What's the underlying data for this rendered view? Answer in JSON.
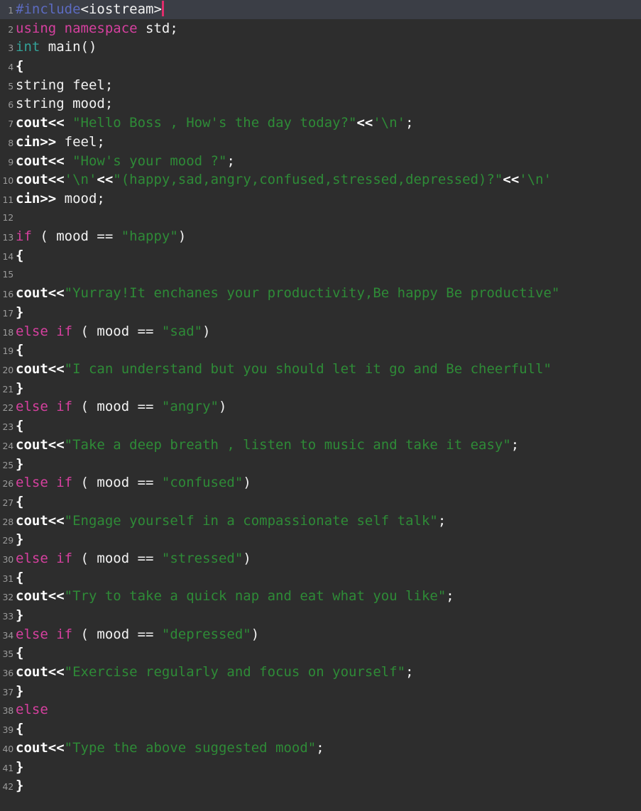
{
  "editor": {
    "language": "C++",
    "background_color": "#2d2d2d",
    "active_line_color": "#3b3e46",
    "gutter_color": "#9a9a9a",
    "cursor_color": "#e02d6b",
    "cursor_line": 1,
    "total_lines": 42,
    "colors": {
      "preprocessor": "#5c6bc0",
      "keyword": "#d6409f",
      "type": "#33a298",
      "string": "#2e8b37",
      "plain": "#f2f2f2"
    }
  },
  "lines": [
    {
      "n": "1",
      "active": true,
      "tokens": [
        {
          "c": "pre",
          "t": "#include"
        },
        {
          "c": "plain",
          "t": "<iostream>"
        }
      ],
      "cursor": true
    },
    {
      "n": "2",
      "active": false,
      "tokens": [
        {
          "c": "kw",
          "t": "using namespace"
        },
        {
          "c": "plain",
          "t": " std;"
        }
      ]
    },
    {
      "n": "3",
      "active": false,
      "tokens": [
        {
          "c": "type",
          "t": "int"
        },
        {
          "c": "plain",
          "t": " main()"
        }
      ]
    },
    {
      "n": "4",
      "active": false,
      "tokens": [
        {
          "c": "bold",
          "t": "{"
        }
      ]
    },
    {
      "n": "5",
      "active": false,
      "tokens": [
        {
          "c": "plain",
          "t": "string feel;"
        }
      ]
    },
    {
      "n": "6",
      "active": false,
      "tokens": [
        {
          "c": "plain",
          "t": "string mood;"
        }
      ]
    },
    {
      "n": "7",
      "active": false,
      "tokens": [
        {
          "c": "bold",
          "t": "cout<<"
        },
        {
          "c": "plain",
          "t": " "
        },
        {
          "c": "str",
          "t": "\"Hello Boss , How's the day today?\""
        },
        {
          "c": "bold",
          "t": "<<"
        },
        {
          "c": "str",
          "t": "'\\n'"
        },
        {
          "c": "plain",
          "t": ";"
        }
      ]
    },
    {
      "n": "8",
      "active": false,
      "tokens": [
        {
          "c": "bold",
          "t": "cin>>"
        },
        {
          "c": "plain",
          "t": " feel;"
        }
      ]
    },
    {
      "n": "9",
      "active": false,
      "tokens": [
        {
          "c": "bold",
          "t": "cout<<"
        },
        {
          "c": "plain",
          "t": " "
        },
        {
          "c": "str",
          "t": "\"How's your mood ?\""
        },
        {
          "c": "plain",
          "t": ";"
        }
      ]
    },
    {
      "n": "10",
      "active": false,
      "tokens": [
        {
          "c": "bold",
          "t": "cout<<"
        },
        {
          "c": "str",
          "t": "'\\n'"
        },
        {
          "c": "bold",
          "t": "<<"
        },
        {
          "c": "str",
          "t": "\"(happy,sad,angry,confused,stressed,depressed)?\""
        },
        {
          "c": "bold",
          "t": "<<"
        },
        {
          "c": "str",
          "t": "'\\n'"
        }
      ]
    },
    {
      "n": "11",
      "active": false,
      "tokens": [
        {
          "c": "bold",
          "t": "cin>>"
        },
        {
          "c": "plain",
          "t": " mood;"
        }
      ]
    },
    {
      "n": "12",
      "active": false,
      "tokens": []
    },
    {
      "n": "13",
      "active": false,
      "tokens": [
        {
          "c": "kw",
          "t": "if"
        },
        {
          "c": "plain",
          "t": " ( mood == "
        },
        {
          "c": "str",
          "t": "\"happy\""
        },
        {
          "c": "plain",
          "t": ")"
        }
      ]
    },
    {
      "n": "14",
      "active": false,
      "tokens": [
        {
          "c": "bold",
          "t": "{"
        }
      ]
    },
    {
      "n": "15",
      "active": false,
      "tokens": []
    },
    {
      "n": "16",
      "active": false,
      "tokens": [
        {
          "c": "bold",
          "t": "cout<<"
        },
        {
          "c": "str",
          "t": "\"Yurray!It enchanes your productivity,Be happy Be productive\""
        }
      ]
    },
    {
      "n": "17",
      "active": false,
      "tokens": [
        {
          "c": "bold",
          "t": "}"
        }
      ]
    },
    {
      "n": "18",
      "active": false,
      "tokens": [
        {
          "c": "kw",
          "t": "else if"
        },
        {
          "c": "plain",
          "t": " ( mood == "
        },
        {
          "c": "str",
          "t": "\"sad\""
        },
        {
          "c": "plain",
          "t": ")"
        }
      ]
    },
    {
      "n": "19",
      "active": false,
      "tokens": [
        {
          "c": "bold",
          "t": "{"
        }
      ]
    },
    {
      "n": "20",
      "active": false,
      "tokens": [
        {
          "c": "bold",
          "t": "cout<<"
        },
        {
          "c": "str",
          "t": "\"I can understand but you should let it go and Be cheerfull\""
        }
      ]
    },
    {
      "n": "21",
      "active": false,
      "tokens": [
        {
          "c": "bold",
          "t": "}"
        }
      ]
    },
    {
      "n": "22",
      "active": false,
      "tokens": [
        {
          "c": "kw",
          "t": "else if"
        },
        {
          "c": "plain",
          "t": " ( mood == "
        },
        {
          "c": "str",
          "t": "\"angry\""
        },
        {
          "c": "plain",
          "t": ")"
        }
      ]
    },
    {
      "n": "23",
      "active": false,
      "tokens": [
        {
          "c": "bold",
          "t": "{"
        }
      ]
    },
    {
      "n": "24",
      "active": false,
      "tokens": [
        {
          "c": "bold",
          "t": "cout<<"
        },
        {
          "c": "str",
          "t": "\"Take a deep breath , listen to music and take it easy\""
        },
        {
          "c": "plain",
          "t": ";"
        }
      ]
    },
    {
      "n": "25",
      "active": false,
      "tokens": [
        {
          "c": "bold",
          "t": "}"
        }
      ]
    },
    {
      "n": "26",
      "active": false,
      "tokens": [
        {
          "c": "kw",
          "t": "else if"
        },
        {
          "c": "plain",
          "t": " ( mood == "
        },
        {
          "c": "str",
          "t": "\"confused\""
        },
        {
          "c": "plain",
          "t": ")"
        }
      ]
    },
    {
      "n": "27",
      "active": false,
      "tokens": [
        {
          "c": "bold",
          "t": "{"
        }
      ]
    },
    {
      "n": "28",
      "active": false,
      "tokens": [
        {
          "c": "bold",
          "t": "cout<<"
        },
        {
          "c": "str",
          "t": "\"Engage yourself in a compassionate self talk\""
        },
        {
          "c": "plain",
          "t": ";"
        }
      ]
    },
    {
      "n": "29",
      "active": false,
      "tokens": [
        {
          "c": "bold",
          "t": "}"
        }
      ]
    },
    {
      "n": "30",
      "active": false,
      "tokens": [
        {
          "c": "kw",
          "t": "else if"
        },
        {
          "c": "plain",
          "t": " ( mood == "
        },
        {
          "c": "str",
          "t": "\"stressed\""
        },
        {
          "c": "plain",
          "t": ")"
        }
      ]
    },
    {
      "n": "31",
      "active": false,
      "tokens": [
        {
          "c": "bold",
          "t": "{"
        }
      ]
    },
    {
      "n": "32",
      "active": false,
      "tokens": [
        {
          "c": "bold",
          "t": "cout<<"
        },
        {
          "c": "str",
          "t": "\"Try to take a quick nap and eat what you like\""
        },
        {
          "c": "plain",
          "t": ";"
        }
      ]
    },
    {
      "n": "33",
      "active": false,
      "tokens": [
        {
          "c": "bold",
          "t": "}"
        }
      ]
    },
    {
      "n": "34",
      "active": false,
      "tokens": [
        {
          "c": "kw",
          "t": "else if"
        },
        {
          "c": "plain",
          "t": " ( mood == "
        },
        {
          "c": "str",
          "t": "\"depressed\""
        },
        {
          "c": "plain",
          "t": ")"
        }
      ]
    },
    {
      "n": "35",
      "active": false,
      "tokens": [
        {
          "c": "bold",
          "t": "{"
        }
      ]
    },
    {
      "n": "36",
      "active": false,
      "tokens": [
        {
          "c": "bold",
          "t": "cout<<"
        },
        {
          "c": "str",
          "t": "\"Exercise regularly and focus on yourself\""
        },
        {
          "c": "plain",
          "t": ";"
        }
      ]
    },
    {
      "n": "37",
      "active": false,
      "tokens": [
        {
          "c": "bold",
          "t": "}"
        }
      ]
    },
    {
      "n": "38",
      "active": false,
      "tokens": [
        {
          "c": "kw",
          "t": "else"
        }
      ]
    },
    {
      "n": "39",
      "active": false,
      "tokens": [
        {
          "c": "bold",
          "t": "{"
        }
      ]
    },
    {
      "n": "40",
      "active": false,
      "tokens": [
        {
          "c": "bold",
          "t": "cout<<"
        },
        {
          "c": "str",
          "t": "\"Type the above suggested mood\""
        },
        {
          "c": "plain",
          "t": ";"
        }
      ]
    },
    {
      "n": "41",
      "active": false,
      "tokens": [
        {
          "c": "bold",
          "t": "}"
        }
      ]
    },
    {
      "n": "42",
      "active": false,
      "tokens": [
        {
          "c": "bold",
          "t": "}"
        }
      ]
    }
  ]
}
